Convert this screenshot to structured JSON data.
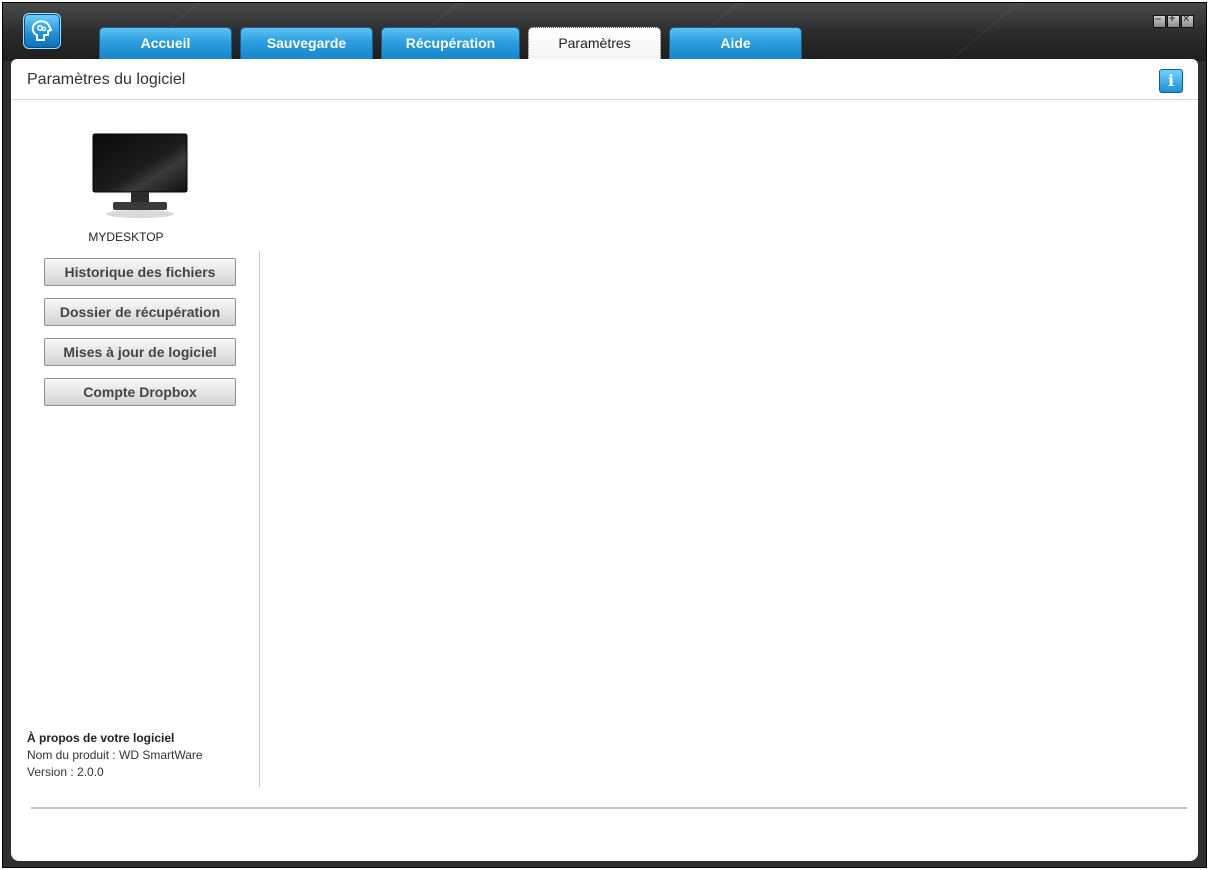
{
  "window": {
    "tabs": [
      {
        "label": "Accueil",
        "active": false
      },
      {
        "label": "Sauvegarde",
        "active": false
      },
      {
        "label": "Récupération",
        "active": false
      },
      {
        "label": "Paramètres",
        "active": true
      },
      {
        "label": "Aide",
        "active": false
      }
    ],
    "controls": [
      "minimize-icon",
      "maximize-icon",
      "close-icon"
    ]
  },
  "page": {
    "title": "Paramètres du logiciel",
    "info_label": "i"
  },
  "device": {
    "name": "MYDESKTOP",
    "icon": "monitor-icon"
  },
  "menu": [
    {
      "label": "Historique des fichiers"
    },
    {
      "label": "Dossier de récupération"
    },
    {
      "label": "Mises à jour de logiciel"
    },
    {
      "label": "Compte Dropbox"
    }
  ],
  "about": {
    "heading": "À propos de votre logiciel",
    "product": "Nom du produit : WD SmartWare",
    "version": "Version : 2.0.0"
  },
  "colors": {
    "tab_blue": "#2b9ee0",
    "titlebar_dark": "#2a2a2a",
    "content_bg": "#ffffff"
  }
}
